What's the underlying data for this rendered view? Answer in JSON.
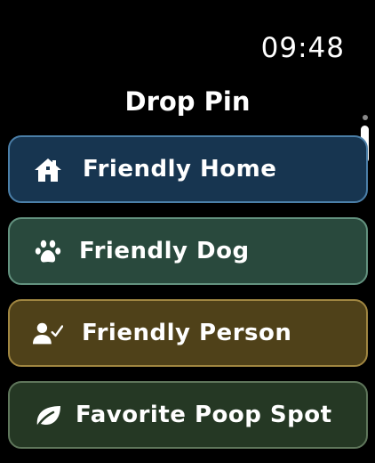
{
  "status": {
    "time": "09:48"
  },
  "screen": {
    "title": "Drop Pin"
  },
  "items": [
    {
      "label": "Friendly Home",
      "icon": "house-icon",
      "background": "#173550",
      "border": "#4b7fa8"
    },
    {
      "label": "Friendly Dog",
      "icon": "paw-icon",
      "background": "#29493d",
      "border": "#63927f"
    },
    {
      "label": "Friendly Person",
      "icon": "person-check-icon",
      "background": "#4f4119",
      "border": "#a08641"
    },
    {
      "label": "Favorite Poop Spot",
      "icon": "leaf-icon",
      "background": "#253824",
      "border": "#5f765b"
    }
  ]
}
